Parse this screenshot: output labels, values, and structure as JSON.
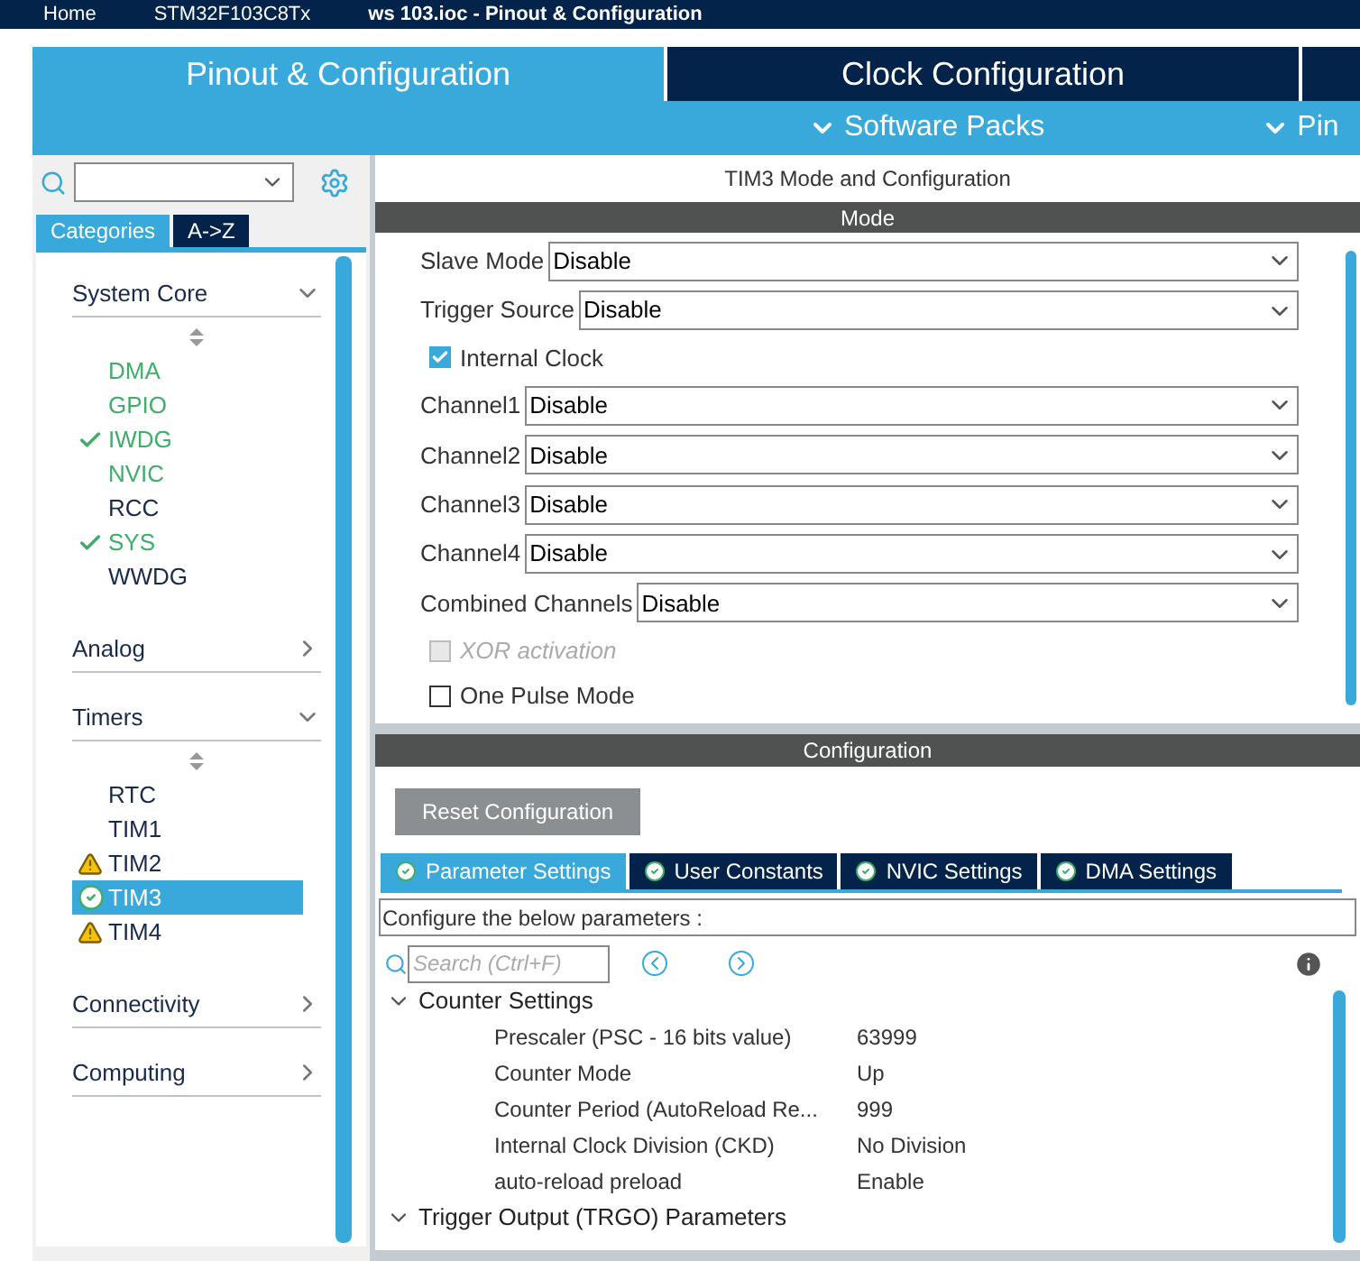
{
  "breadcrumb": [
    "Home",
    "STM32F103C8Tx",
    "ws 103.ioc - Pinout & Configuration"
  ],
  "main_tabs": [
    {
      "label": "Pinout & Configuration",
      "selected": true
    },
    {
      "label": "Clock Configuration",
      "selected": false
    }
  ],
  "menus": [
    "Software Packs",
    "Pin"
  ],
  "sidebar": {
    "view_tabs": [
      {
        "label": "Categories",
        "selected": true
      },
      {
        "label": "A->Z",
        "selected": false
      }
    ],
    "categories": [
      {
        "name": "System Core",
        "expanded": true,
        "items": [
          {
            "label": "DMA",
            "kind": "plain",
            "active": true,
            "selected": false
          },
          {
            "label": "GPIO",
            "kind": "plain",
            "active": true,
            "selected": false
          },
          {
            "label": "IWDG",
            "kind": "check",
            "active": true,
            "selected": false
          },
          {
            "label": "NVIC",
            "kind": "plain",
            "active": true,
            "selected": false
          },
          {
            "label": "RCC",
            "kind": "plain",
            "active": false,
            "selected": false
          },
          {
            "label": "SYS",
            "kind": "check",
            "active": true,
            "selected": false
          },
          {
            "label": "WWDG",
            "kind": "plain",
            "active": false,
            "selected": false
          }
        ]
      },
      {
        "name": "Analog",
        "expanded": false
      },
      {
        "name": "Timers",
        "expanded": true,
        "items": [
          {
            "label": "RTC",
            "kind": "plain",
            "active": false,
            "selected": false
          },
          {
            "label": "TIM1",
            "kind": "plain",
            "active": false,
            "selected": false
          },
          {
            "label": "TIM2",
            "kind": "warning",
            "active": false,
            "selected": false
          },
          {
            "label": "TIM3",
            "kind": "ok",
            "active": false,
            "selected": true
          },
          {
            "label": "TIM4",
            "kind": "warning",
            "active": false,
            "selected": false
          }
        ]
      },
      {
        "name": "Connectivity",
        "expanded": false
      },
      {
        "name": "Computing",
        "expanded": false
      }
    ]
  },
  "mode_panel": {
    "title": "TIM3 Mode and Configuration",
    "section": "Mode",
    "fields": [
      {
        "kind": "select",
        "label": "Slave Mode",
        "value": "Disable"
      },
      {
        "kind": "select",
        "label": "Trigger Source",
        "value": "Disable"
      },
      {
        "kind": "checkbox",
        "label": "Internal Clock",
        "checked": true,
        "disabled": false
      },
      {
        "kind": "select",
        "label": "Channel1",
        "value": "Disable"
      },
      {
        "kind": "select",
        "label": "Channel2",
        "value": "Disable"
      },
      {
        "kind": "select",
        "label": "Channel3",
        "value": "Disable"
      },
      {
        "kind": "select",
        "label": "Channel4",
        "value": "Disable"
      },
      {
        "kind": "select",
        "label": "Combined Channels",
        "value": "Disable"
      },
      {
        "kind": "checkbox",
        "label": "XOR activation",
        "checked": false,
        "disabled": true
      },
      {
        "kind": "checkbox",
        "label": "One Pulse Mode",
        "checked": false,
        "disabled": false
      }
    ]
  },
  "config_panel": {
    "section": "Configuration",
    "reset_button": "Reset Configuration",
    "tabs": [
      {
        "label": "Parameter Settings",
        "selected": true
      },
      {
        "label": "User Constants",
        "selected": false
      },
      {
        "label": "NVIC Settings",
        "selected": false
      },
      {
        "label": "DMA Settings",
        "selected": false
      }
    ],
    "hint": "Configure the below parameters :",
    "search": {
      "placeholder": "Search (Ctrl+F)"
    },
    "groups": [
      {
        "title": "Counter Settings",
        "expanded": true,
        "params": [
          {
            "name": "Prescaler (PSC - 16 bits value)",
            "value": "63999"
          },
          {
            "name": "Counter Mode",
            "value": "Up"
          },
          {
            "name": "Counter Period (AutoReload Re...",
            "value": "999"
          },
          {
            "name": "Internal Clock Division (CKD)",
            "value": "No Division"
          },
          {
            "name": "auto-reload preload",
            "value": "Enable"
          }
        ]
      },
      {
        "title": "Trigger Output (TRGO) Parameters",
        "expanded": true
      }
    ]
  }
}
